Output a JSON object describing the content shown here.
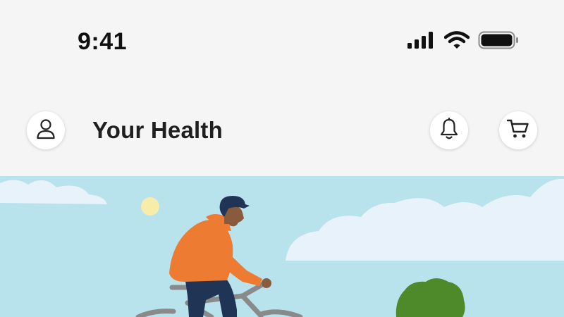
{
  "status_bar": {
    "time": "9:41",
    "icons": [
      "cellular-signal-icon",
      "wifi-icon",
      "battery-icon"
    ]
  },
  "header": {
    "title": "Your Health",
    "left_button_icon": "person-icon",
    "right_button_icons": [
      "bell-icon",
      "cart-icon"
    ]
  },
  "hero": {
    "illustration": "person-riding-bicycle-outdoors",
    "colors": {
      "sky": "#b9e3ec",
      "cloud": "#e8f2fa",
      "sun": "#f7ecaa",
      "jacket": "#ee7b32",
      "pants": "#203455",
      "skin": "#8a5a3c",
      "cap": "#203455",
      "bike": "#8a8a8a",
      "bush": "#4f8a2a"
    }
  },
  "colors": {
    "background": "#f5f5f5",
    "title_text": "#1f1f1f",
    "button_bg": "#ffffff"
  }
}
